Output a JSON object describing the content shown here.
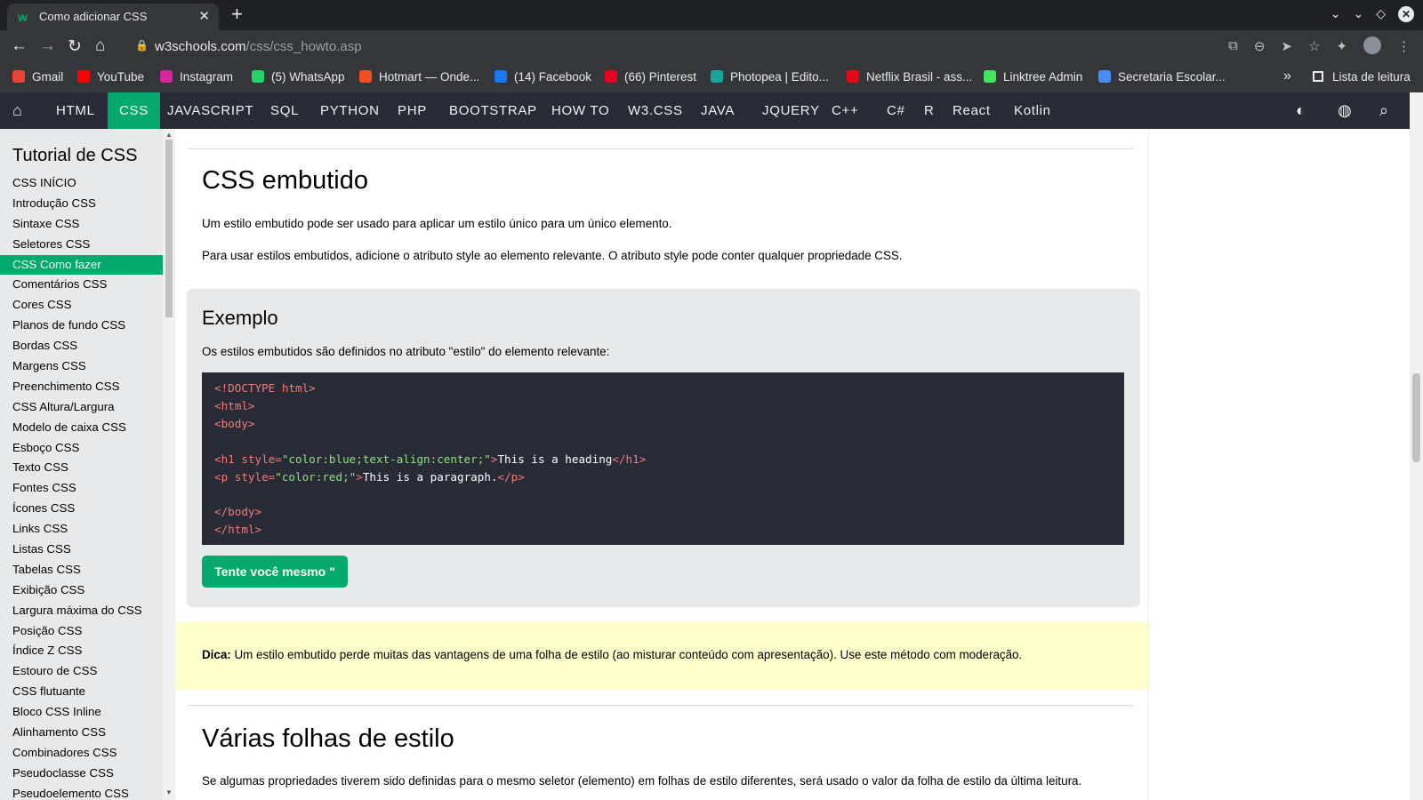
{
  "browser": {
    "tab_icon": "w",
    "tab_title": "Como adicionar CSS",
    "url_domain": "w3schools.com",
    "url_path": "/css/css_howto.asp",
    "bookmarks": [
      {
        "label": "Gmail",
        "color": "#ea4335"
      },
      {
        "label": "YouTube",
        "color": "#ff0000"
      },
      {
        "label": "Instagram",
        "color": "#d6249f"
      },
      {
        "label": "(5) WhatsApp",
        "color": "#25d366"
      },
      {
        "label": "Hotmart — Onde...",
        "color": "#f04e23"
      },
      {
        "label": "(14) Facebook",
        "color": "#1877f2"
      },
      {
        "label": "(66) Pinterest",
        "color": "#e60023"
      },
      {
        "label": "Photopea | Edito...",
        "color": "#18a497"
      },
      {
        "label": "Netflix Brasil - ass...",
        "color": "#e50914"
      },
      {
        "label": "Linktree Admin",
        "color": "#43e55e"
      },
      {
        "label": "Secretaria Escolar...",
        "color": "#4b8bf4"
      }
    ],
    "reading_list": "Lista de leitura"
  },
  "nav": {
    "items": [
      "HTML",
      "CSS",
      "JAVASCRIPT",
      "SQL",
      "PYTHON",
      "PHP",
      "BOOTSTRAP",
      "HOW TO",
      "W3.CSS",
      "JAVA",
      "JQUERY",
      "C++",
      "C#",
      "R",
      "React",
      "Kotlin"
    ],
    "active": "CSS",
    "accent": "#04aa6d"
  },
  "sidebar": {
    "title": "Tutorial de CSS",
    "items": [
      "CSS INÍCIO",
      "Introdução CSS",
      "Sintaxe CSS",
      "Seletores CSS",
      "CSS Como fazer",
      "Comentários CSS",
      "Cores CSS",
      "Planos de fundo CSS",
      "Bordas CSS",
      "Margens CSS",
      "Preenchimento CSS",
      "CSS Altura/Largura",
      "Modelo de caixa CSS",
      "Esboço CSS",
      "Texto CSS",
      "Fontes CSS",
      "Ícones CSS",
      "Links CSS",
      "Listas CSS",
      "Tabelas CSS",
      "Exibição CSS",
      "Largura máxima do CSS",
      "Posição CSS",
      "Índice Z CSS",
      "Estouro de CSS",
      "CSS flutuante",
      "Bloco CSS Inline",
      "Alinhamento CSS",
      "Combinadores CSS",
      "Pseudoclasse CSS",
      "Pseudoelemento CSS"
    ],
    "active_index": 4
  },
  "main": {
    "heading": "CSS embutido",
    "p1": "Um estilo embutido pode ser usado para aplicar um estilo único para um único elemento.",
    "p2": "Para usar estilos embutidos, adicione o atributo style ao elemento relevante. O atributo style pode conter qualquer propriedade CSS.",
    "example_title": "Exemplo",
    "example_desc": "Os estilos embutidos são definidos no atributo \"estilo\" do elemento relevante:",
    "code": {
      "l1_open": "<",
      "l1_tag": "!DOCTYPE",
      "l1_rest": " html>",
      "l2": "<html>",
      "l3": "<body>",
      "l5_tag": "<h1",
      "l5_attr": " style=",
      "l5_val": "\"color:blue;text-align:center;\"",
      "l5_close": ">",
      "l5_text": "This is a heading",
      "l5_end": "</h1>",
      "l6_tag": "<p",
      "l6_attr": " style=",
      "l6_val": "\"color:red;\"",
      "l6_close": ">",
      "l6_text": "This is a paragraph.",
      "l6_end": "</p>",
      "l8": "</body>",
      "l9": "</html>"
    },
    "try_button": "Tente você mesmo \"",
    "tip_label": "Dica:",
    "tip_text": " Um estilo embutido perde muitas das vantagens de uma folha de estilo (ao misturar conteúdo com apresentação). Use este método com moderação.",
    "heading2": "Várias folhas de estilo",
    "p3": "Se algumas propriedades tiverem sido definidas para o mesmo seletor (elemento) em folhas de estilo diferentes, será usado o valor da folha de estilo da última leitura."
  }
}
